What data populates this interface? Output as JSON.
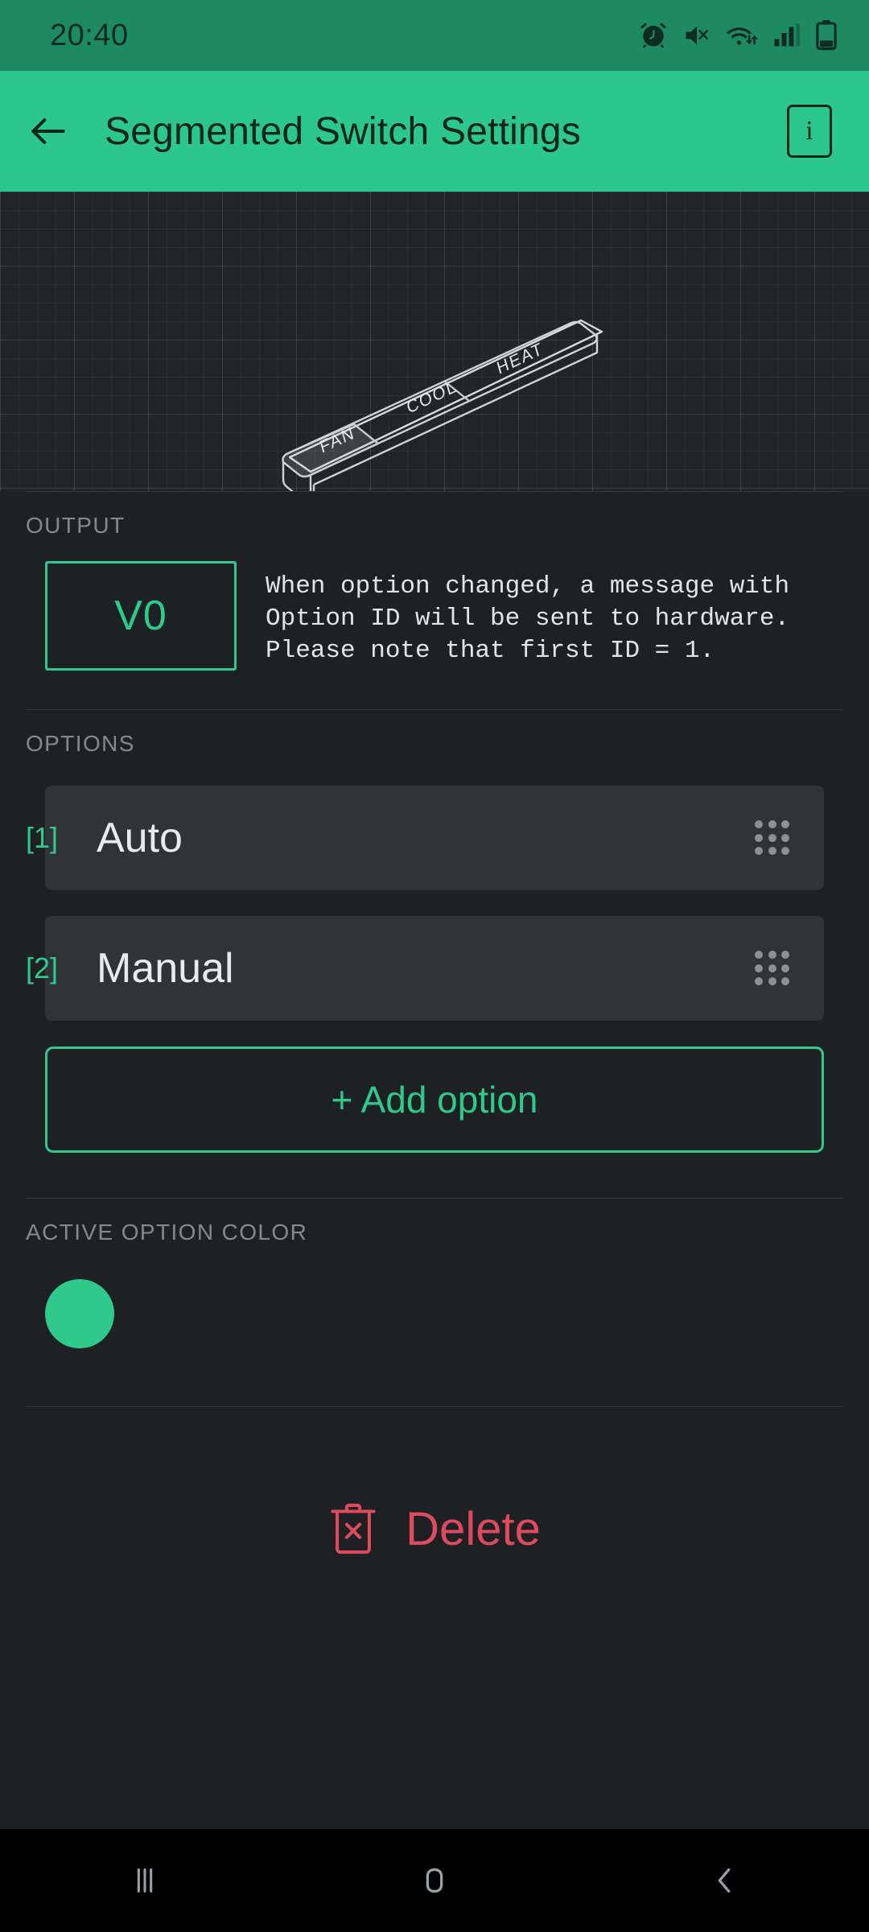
{
  "status_bar": {
    "time": "20:40",
    "icons": [
      "alarm-icon",
      "mute-icon",
      "wifi-icon",
      "signal-icon",
      "battery-icon"
    ]
  },
  "app_bar": {
    "back_icon": "arrow-left-icon",
    "title": "Segmented Switch Settings",
    "info_label": "i"
  },
  "preview": {
    "segments": [
      "FAN",
      "COOL",
      "HEAT"
    ],
    "active_segment": "FAN"
  },
  "output": {
    "section_label": "OUTPUT",
    "pin": "V0",
    "description": "When option changed, a message with\nOption ID will be sent to hardware.\nPlease note that first ID = 1."
  },
  "options": {
    "section_label": "OPTIONS",
    "items": [
      {
        "id": "[1]",
        "label": "Auto"
      },
      {
        "id": "[2]",
        "label": "Manual"
      }
    ],
    "add_label": "+ Add option"
  },
  "active_color": {
    "section_label": "ACTIVE OPTION COLOR",
    "value": "#2EC98B"
  },
  "delete": {
    "label": "Delete",
    "icon": "trash-x-icon",
    "color": "#E04A5F"
  },
  "nav_bar": {
    "recents_icon": "recents-icon",
    "home_icon": "home-icon",
    "back_icon": "back-chevron-icon"
  },
  "theme": {
    "accent": "#2EC98B",
    "appbar": "#2BC78C",
    "statusbar": "#1D8A64",
    "background": "#1E2124"
  }
}
